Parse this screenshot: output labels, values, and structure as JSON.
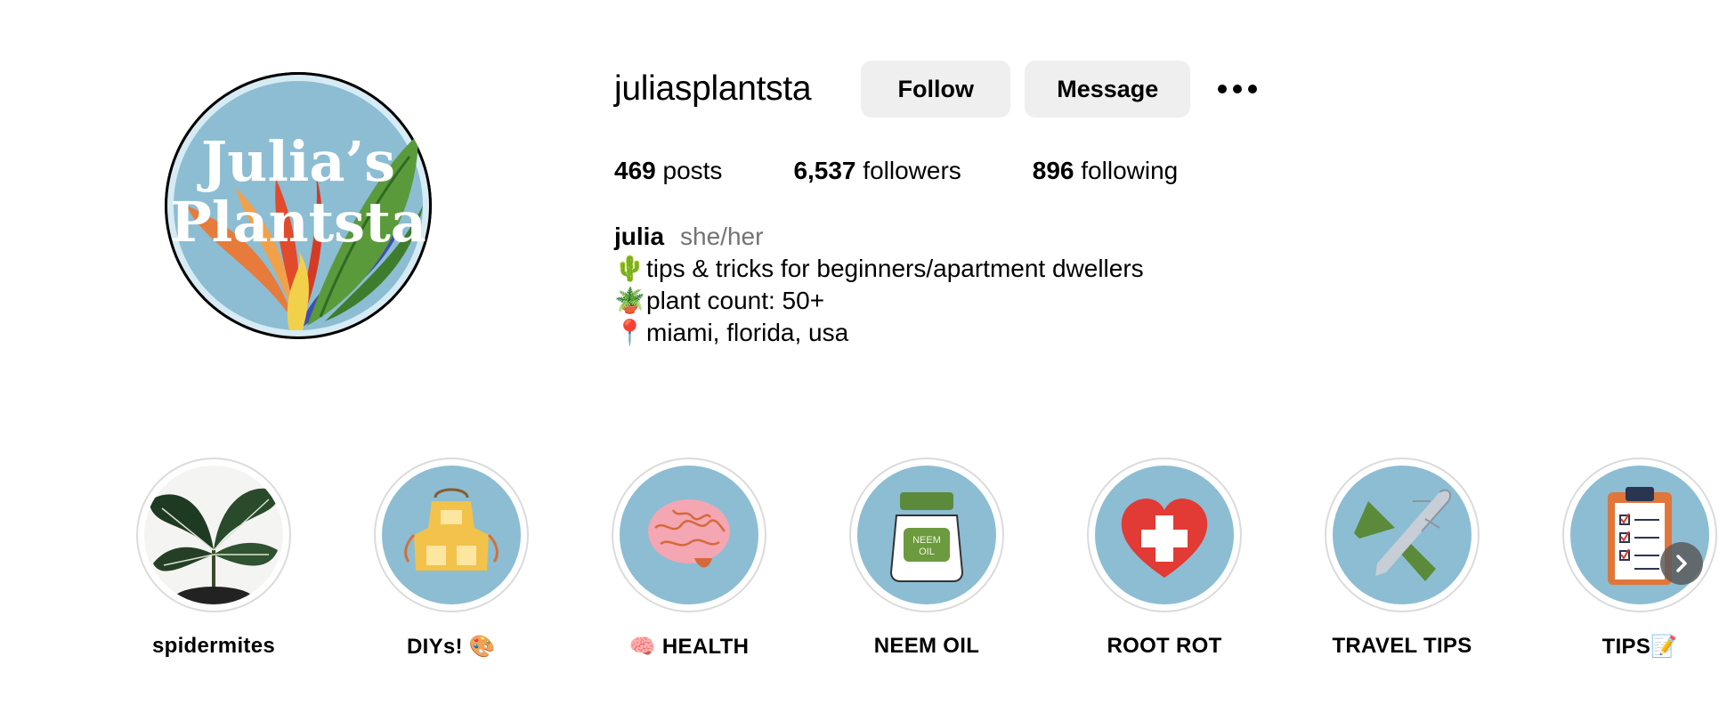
{
  "profile": {
    "avatar_text_line1": "Julia’s",
    "avatar_text_line2": "Plantsta",
    "username": "juliasplantsta",
    "follow_label": "Follow",
    "message_label": "Message"
  },
  "stats": {
    "posts_count": "469",
    "posts_label": "posts",
    "followers_count": "6,537",
    "followers_label": "followers",
    "following_count": "896",
    "following_label": "following"
  },
  "bio": {
    "name": "julia",
    "pronouns": "she/her",
    "lines": [
      {
        "emoji": "🌵",
        "text": "tips & tricks for beginners/apartment dwellers"
      },
      {
        "emoji": "🪴",
        "text": "plant count: 50+"
      },
      {
        "emoji": "📍",
        "text": "miami, florida, usa"
      }
    ]
  },
  "highlights": [
    {
      "label": "spidermites",
      "icon": "plant-photo-icon"
    },
    {
      "label": "DIYs! 🎨",
      "icon": "apron-icon"
    },
    {
      "label": "🧠 HEALTH",
      "icon": "brain-icon"
    },
    {
      "label": "NEEM OIL",
      "icon": "neem-oil-jar-icon",
      "jar_text": "NEEM OIL"
    },
    {
      "label": "ROOT ROT",
      "icon": "heart-cross-icon"
    },
    {
      "label": "TRAVEL TIPS",
      "icon": "airplane-icon"
    },
    {
      "label": "TIPS📝",
      "icon": "clipboard-icon"
    }
  ],
  "colors": {
    "highlight_bg": "#8cbdd3",
    "button_bg": "#efefef",
    "secondary_text": "#737373"
  }
}
